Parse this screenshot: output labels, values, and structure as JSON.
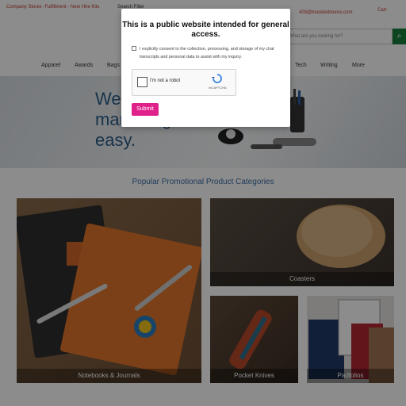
{
  "topbar": {
    "links": "Company Stores  -Fulfillment  - New Hire Kits",
    "search_filter": "Search Filter",
    "email": "403@brandedstores.com",
    "cart": "Cart"
  },
  "search": {
    "placeholder": "What are you looking for?"
  },
  "nav": {
    "items": [
      "Apparel",
      "Awards",
      "Bags",
      "Tech",
      "Writing",
      "More"
    ]
  },
  "hero": {
    "line1": "We",
    "line2": "marketing",
    "line3": "easy."
  },
  "categories": {
    "title": "Popular Promotional Product Categories",
    "tiles": [
      {
        "label": "Notebooks & Journals"
      },
      {
        "label": "Coasters"
      },
      {
        "label": "Pocket Knives"
      },
      {
        "label": "Padfolios"
      }
    ]
  },
  "modal": {
    "title": "This is a public website intended for general access.",
    "consent": "I explicitly consent to the collection, processing, and storage of my chat transcripts and personal data to assist with my inquiry.",
    "recaptcha_label": "I'm not a robot",
    "recaptcha_brand": "reCAPTCHA",
    "submit": "Submit"
  },
  "colors": {
    "accent": "#e0218a",
    "link": "#c0392b",
    "title_blue": "#3a6ea5",
    "search_green": "#1a7f3c"
  }
}
